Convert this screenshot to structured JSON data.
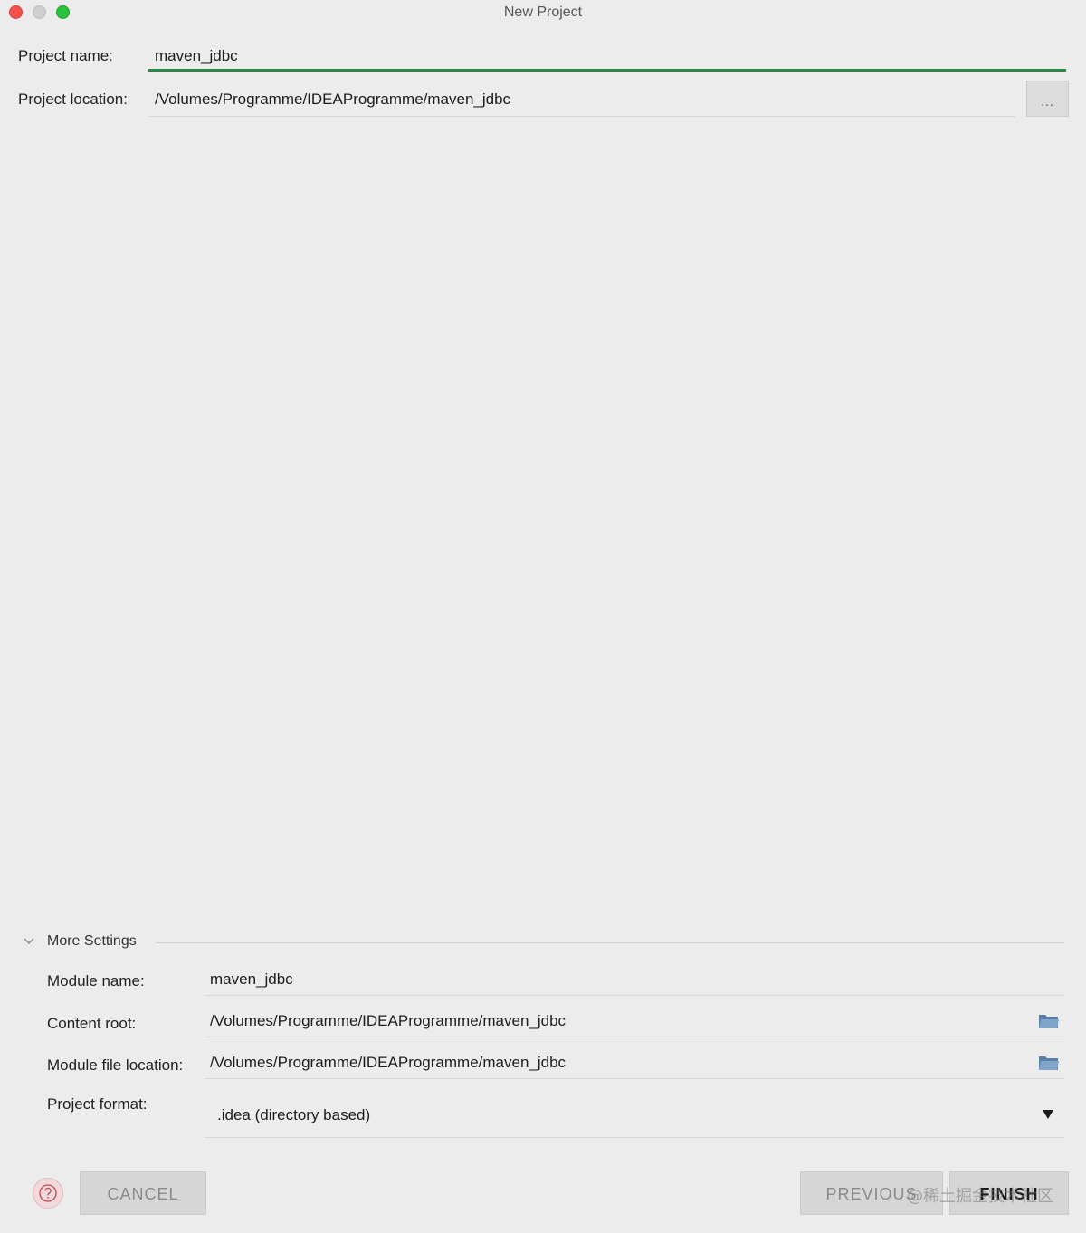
{
  "window": {
    "title": "New Project"
  },
  "project": {
    "name_label": "Project name:",
    "name_value": "maven_jdbc",
    "location_label": "Project location:",
    "location_value": "/Volumes/Programme/IDEAProgramme/maven_jdbc",
    "browse_label": "..."
  },
  "more_settings": {
    "title": "More Settings",
    "module_name_label": "Module name:",
    "module_name_value": "maven_jdbc",
    "content_root_label": "Content root:",
    "content_root_value": "/Volumes/Programme/IDEAProgramme/maven_jdbc",
    "module_file_location_label": "Module file location:",
    "module_file_location_value": "/Volumes/Programme/IDEAProgramme/maven_jdbc",
    "project_format_label": "Project format:",
    "project_format_value": ".idea (directory based)"
  },
  "footer": {
    "cancel_label": "CANCEL",
    "previous_label": "PREVIOUS",
    "finish_label": "FINISH",
    "watermark": "@稀土掘金技术社区"
  },
  "colors": {
    "accent_green": "#2b8a3e",
    "background": "#ececec",
    "close_red": "#f4524b",
    "zoom_green": "#28c23c"
  }
}
